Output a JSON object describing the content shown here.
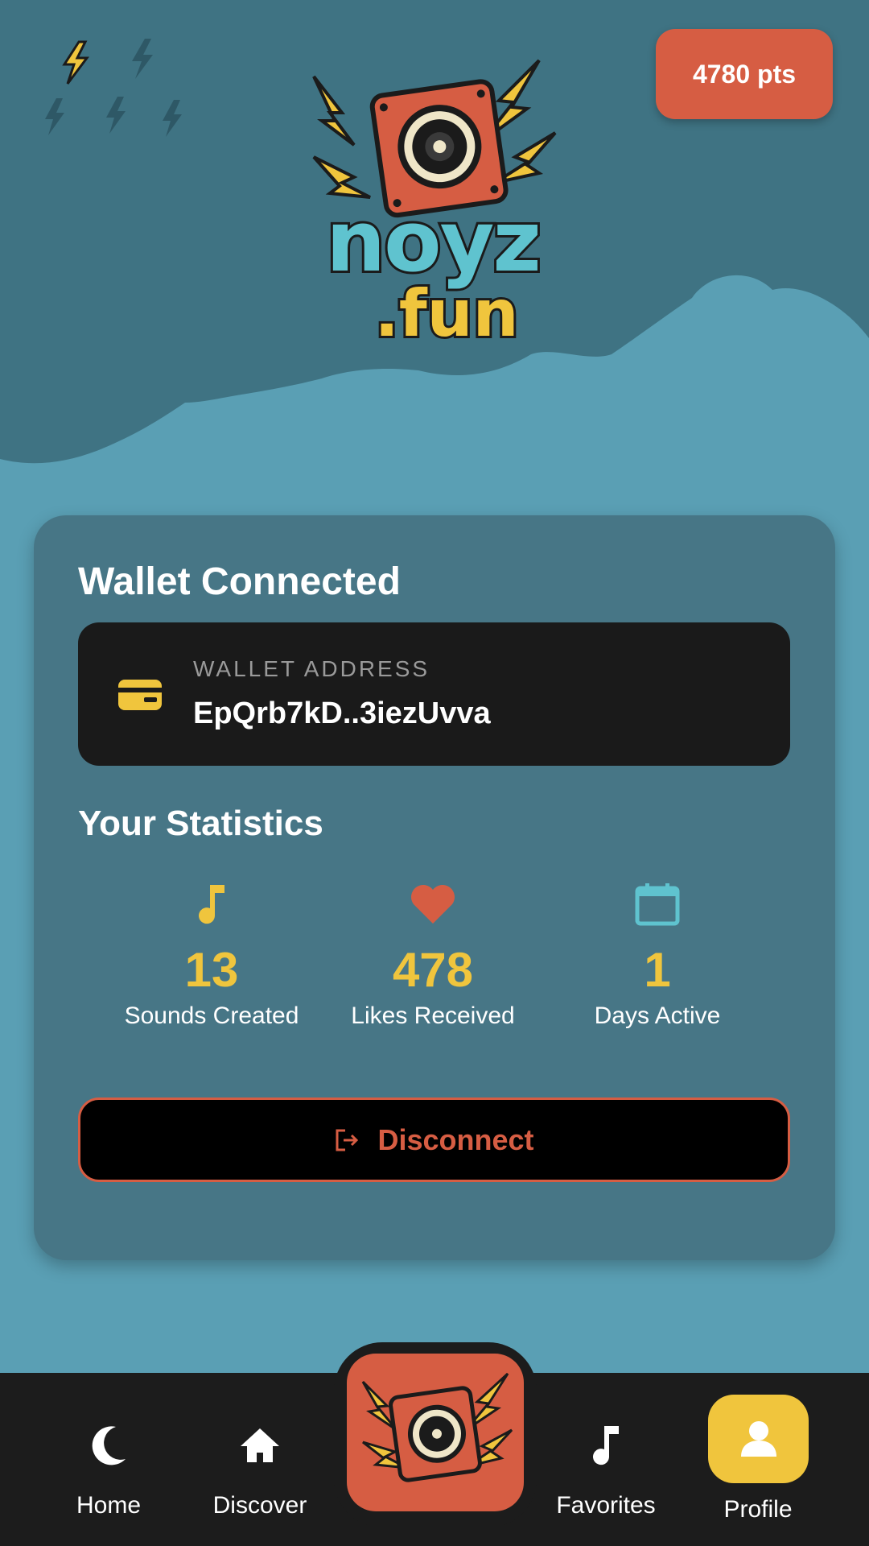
{
  "header": {
    "points": "4780 pts",
    "logo_word": "noyz",
    "logo_sub": ".fun"
  },
  "wallet": {
    "title": "Wallet Connected",
    "label": "WALLET ADDRESS",
    "address": "EpQrb7kD..3iezUvva"
  },
  "stats": {
    "title": "Your Statistics",
    "items": [
      {
        "value": "13",
        "label": "Sounds Created",
        "icon": "music-note-icon",
        "color": "#f0c53d"
      },
      {
        "value": "478",
        "label": "Likes Received",
        "icon": "heart-icon",
        "color": "#d65d43"
      },
      {
        "value": "1",
        "label": "Days Active",
        "icon": "calendar-icon",
        "color": "#5fc3cf"
      }
    ]
  },
  "actions": {
    "disconnect_label": "Disconnect"
  },
  "nav": {
    "items": [
      {
        "label": "Home",
        "icon": "moon-icon"
      },
      {
        "label": "Discover",
        "icon": "house-icon"
      },
      {
        "label": "Favorites",
        "icon": "music-note-icon"
      },
      {
        "label": "Profile",
        "icon": "user-icon"
      }
    ]
  },
  "colors": {
    "background": "#5a9fb4",
    "card": "#477686",
    "accent_red": "#d65d43",
    "accent_yellow": "#f0c53d",
    "dark": "#1c1c1c"
  }
}
